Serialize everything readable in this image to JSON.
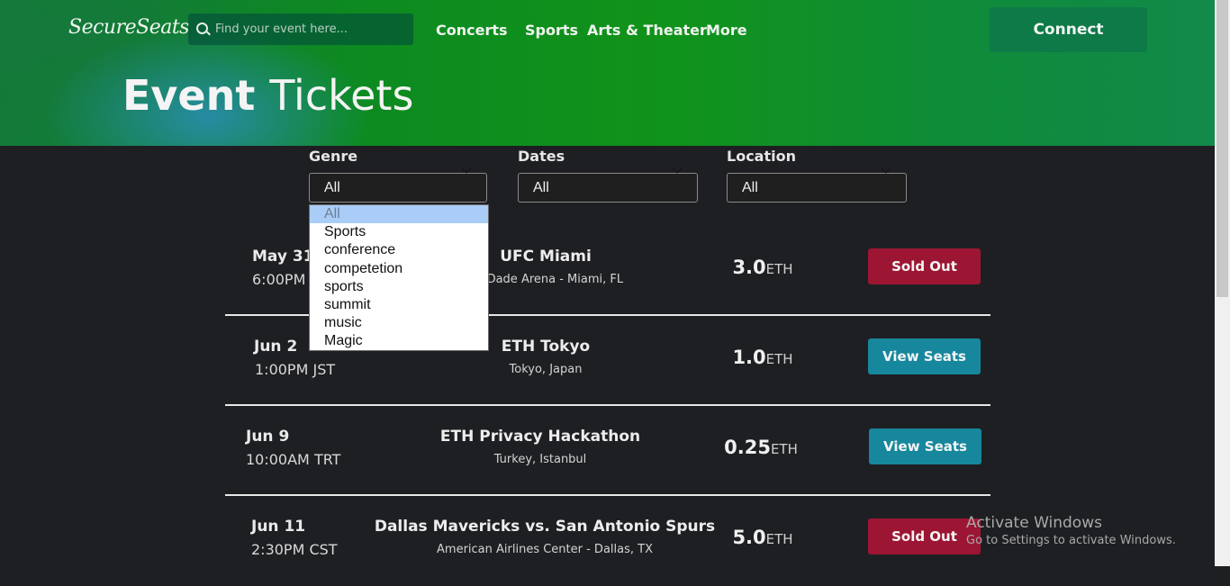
{
  "app": {
    "logo": "SecureSeats"
  },
  "search": {
    "placeholder": "Find your event here..."
  },
  "nav": [
    "Concerts",
    "Sports",
    "Arts & Theater",
    "More"
  ],
  "header": {
    "connect_label": "Connect",
    "title_bold": "Event",
    "title_light": "Tickets"
  },
  "filters": {
    "genre": {
      "label": "Genre",
      "value": "All",
      "options": [
        "All",
        "Sports",
        "conference",
        "competetion",
        "sports",
        "summit",
        "music",
        "Magic"
      ],
      "open": true
    },
    "dates": {
      "label": "Dates",
      "value": "All"
    },
    "location": {
      "label": "Location",
      "value": "All"
    }
  },
  "events": [
    {
      "date": "May 31",
      "time": "6:00PM",
      "name": "UFC Miami",
      "venue": "...i-Dade Arena - Miami, FL",
      "price": "3.0",
      "unit": "ETH",
      "action": "Sold Out",
      "status": "sold"
    },
    {
      "date": "Jun 2",
      "time": "1:00PM JST",
      "name": "ETH Tokyo",
      "venue": "Tokyo, Japan",
      "price": "1.0",
      "unit": "ETH",
      "action": "View Seats",
      "status": "available"
    },
    {
      "date": "Jun 9",
      "time": "10:00AM TRT",
      "name": "ETH Privacy Hackathon",
      "venue": "Turkey, Istanbul",
      "price": "0.25",
      "unit": "ETH",
      "action": "View Seats",
      "status": "available"
    },
    {
      "date": "Jun 11",
      "time": "2:30PM CST",
      "name": "Dallas Mavericks vs. San Antonio Spurs",
      "venue": "American Airlines Center - Dallas, TX",
      "price": "5.0",
      "unit": "ETH",
      "action": "Sold Out",
      "status": "sold"
    }
  ],
  "windows_notice": {
    "title": "Activate Windows",
    "subtitle": "Go to Settings to activate Windows."
  },
  "colors": {
    "sold_out": "#9c1634",
    "view_seats": "#16879c",
    "connect": "#0e7a48",
    "background": "#1e1f22"
  }
}
